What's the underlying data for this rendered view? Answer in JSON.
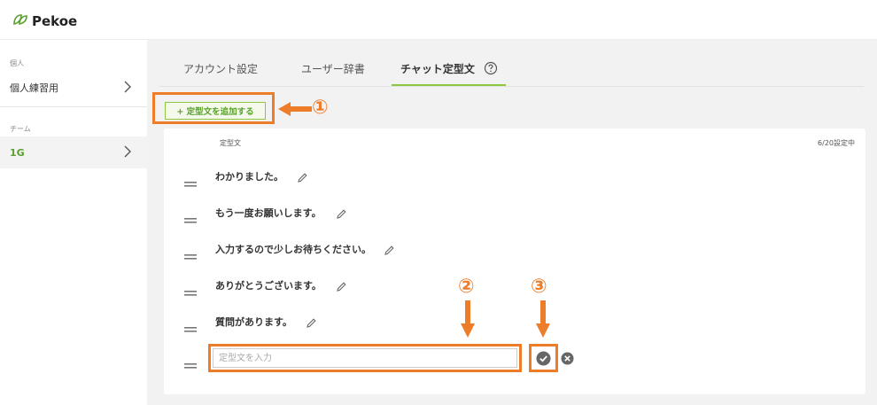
{
  "app": {
    "name": "Pekoe"
  },
  "sidebar": {
    "personal_section_label": "個人",
    "personal_item": "個人練習用",
    "team_section_label": "チーム",
    "team_item": "1G"
  },
  "tabs": [
    {
      "label": "アカウント設定"
    },
    {
      "label": "ユーザー辞書"
    },
    {
      "label": "チャット定型文"
    }
  ],
  "toolbar": {
    "add_label": "+ 定型文を追加する"
  },
  "list": {
    "column_header": "定型文",
    "count": "6/20設定中",
    "items": [
      {
        "text": "わかりました。"
      },
      {
        "text": "もう一度お願いします。"
      },
      {
        "text": "入力するので少しお待ちください。"
      },
      {
        "text": "ありがとうございます。"
      },
      {
        "text": "質問があります。"
      }
    ],
    "input_placeholder": "定型文を入力"
  },
  "annotations": {
    "one": "①",
    "two": "②",
    "three": "③"
  },
  "colors": {
    "accent": "#8dc63f",
    "annotation": "#ee7d2a"
  }
}
